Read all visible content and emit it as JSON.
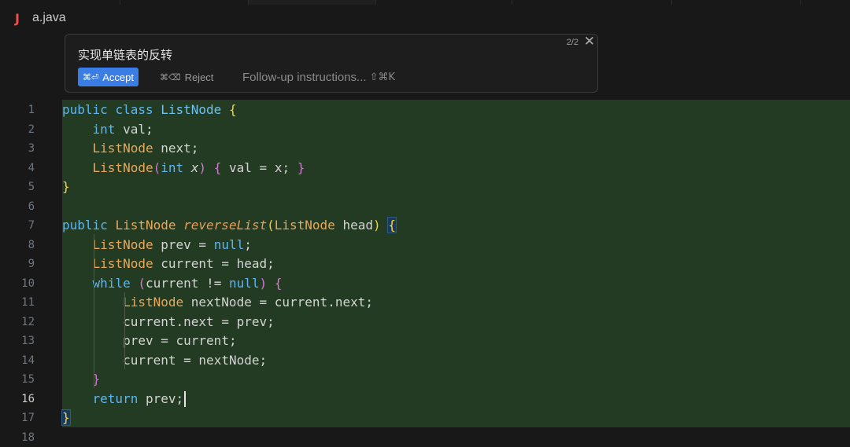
{
  "breadcrumb": {
    "file_icon": "J",
    "file_name": "a.java"
  },
  "inline_edit": {
    "prompt": "实现单链表的反转",
    "counter": "2/2",
    "close_glyph": "✕",
    "accept": {
      "shortcut": "⌘⏎",
      "label": "Accept"
    },
    "reject": {
      "shortcut": "⌘⌫",
      "label": "Reject"
    },
    "followup": {
      "placeholder": "Follow-up instructions...",
      "shortcut": "⇧⌘K"
    }
  },
  "editor": {
    "current_line": 16,
    "line_numbers": [
      "1",
      "2",
      "3",
      "4",
      "5",
      "6",
      "7",
      "8",
      "9",
      "10",
      "11",
      "12",
      "13",
      "14",
      "15",
      "16",
      "17",
      "18"
    ],
    "lines": [
      "public class ListNode {",
      "    int val;",
      "    ListNode next;",
      "    ListNode(int x) { val = x; }",
      "}",
      "",
      "public ListNode reverseList(ListNode head) {",
      "    ListNode prev = null;",
      "    ListNode current = head;",
      "    while (current != null) {",
      "        ListNode nextNode = current.next;",
      "        current.next = prev;",
      "        prev = current;",
      "        current = nextNode;",
      "    }",
      "    return prev;",
      "}",
      ""
    ]
  },
  "colors": {
    "diff_added_bg": "#233b22",
    "accept_button": "#3a7ee5",
    "keyword": "#5db5f2",
    "type": "#e9a85b",
    "bracket_yellow": "#f6d33d",
    "bracket_purple": "#d178d0"
  }
}
